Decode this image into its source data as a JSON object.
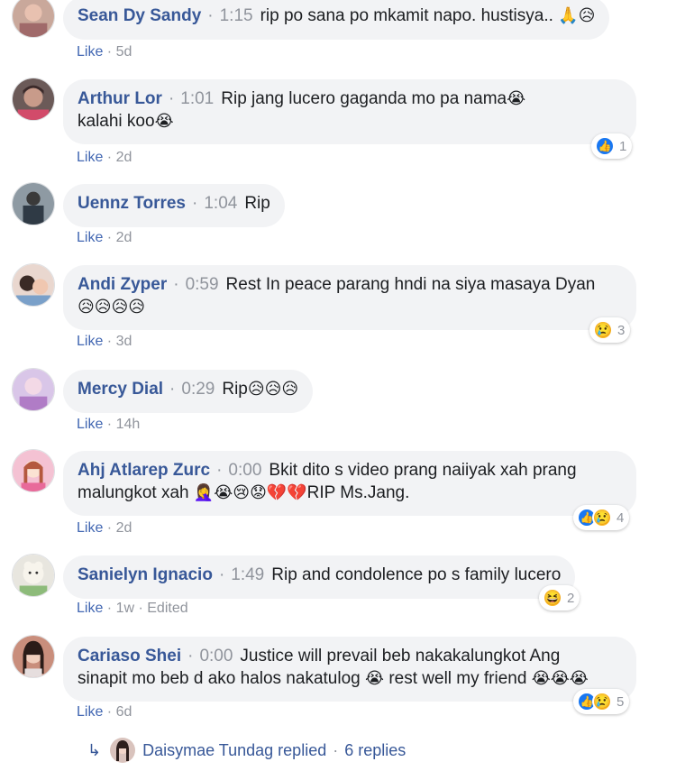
{
  "comments": [
    {
      "author": "Sean Dy Sandy",
      "time": "1:15",
      "text": "rip po sana po mkamit napo. hustisya..",
      "emoji": "🙏😥",
      "like": "Like",
      "age": "5d",
      "reactions": null
    },
    {
      "author": "Arthur Lor",
      "time": "1:01",
      "text": "Rip jang lucero gaganda mo pa nama",
      "emoji": "😭",
      "text2": "kalahi koo",
      "emoji2": "😭",
      "like": "Like",
      "age": "2d",
      "reactions": {
        "count": "1"
      }
    },
    {
      "author": "Uennz Torres",
      "time": "1:04",
      "text": "Rip",
      "like": "Like",
      "age": "2d",
      "reactions": null
    },
    {
      "author": "Andi Zyper",
      "time": "0:59",
      "text": "Rest In peace parang hndi na siya masaya Dyan",
      "emoji2": "😥😥😥😥",
      "like": "Like",
      "age": "3d",
      "reactions": {
        "count": "3"
      }
    },
    {
      "author": "Mercy Dial",
      "time": "0:29",
      "text": "Rip",
      "emoji": "😥😥😥",
      "like": "Like",
      "age": "14h",
      "reactions": null
    },
    {
      "author": "Ahj Atlarep Zurc",
      "time": "0:00",
      "text": "Bkit dito s video prang naiiyak xah prang",
      "text2": "malungkot xah",
      "emoji2": "🤦‍♀️😭😢😟💔💔",
      "text3": "RIP Ms.Jang.",
      "like": "Like",
      "age": "2d",
      "reactions": {
        "count": "4"
      }
    },
    {
      "author": "Sanielyn Ignacio",
      "time": "1:49",
      "text": "Rip and condolence po s family lucero",
      "like": "Like",
      "age": "1w",
      "edited": "Edited",
      "reactions": {
        "count": "2"
      }
    },
    {
      "author": "Cariaso Shei",
      "time": "0:00",
      "text": "Justice will prevail beb nakakalungkot Ang",
      "text2": "sinapit mo beb d ako halos nakatulog",
      "emoji2": "😭",
      "text3": "rest well my friend",
      "emoji3": "😭😭😭",
      "like": "Like",
      "age": "6d",
      "reactions": {
        "count": "5"
      }
    }
  ],
  "replies": {
    "name": "Daisymae Tundag replied",
    "count": "6 replies"
  }
}
